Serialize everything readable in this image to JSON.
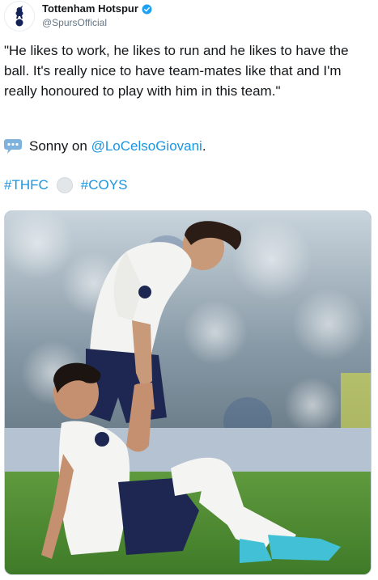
{
  "header": {
    "display_name": "Tottenham Hotspur",
    "handle": "@SpursOfficial",
    "verified": true
  },
  "tweet": {
    "quote": "\"He likes to work, he likes to run and he likes to have the ball. It's really nice to have team-mates like that and I'm really honoured to play with him in this team.\"",
    "credit_prefix": "Sonny on ",
    "mention": "@LoCelsoGiovani",
    "credit_suffix": ".",
    "hashtag_1": "#THFC",
    "hashtag_2": "#COYS"
  },
  "icons": {
    "avatar": "spurs-cockerel-logo",
    "verified": "verified-badge-icon",
    "speech": "speech-balloon-icon",
    "ball": "football-emoji-icon"
  },
  "colors": {
    "link": "#1b95e0",
    "text": "#14171a",
    "secondary": "#657786",
    "verified": "#1da1f2"
  }
}
